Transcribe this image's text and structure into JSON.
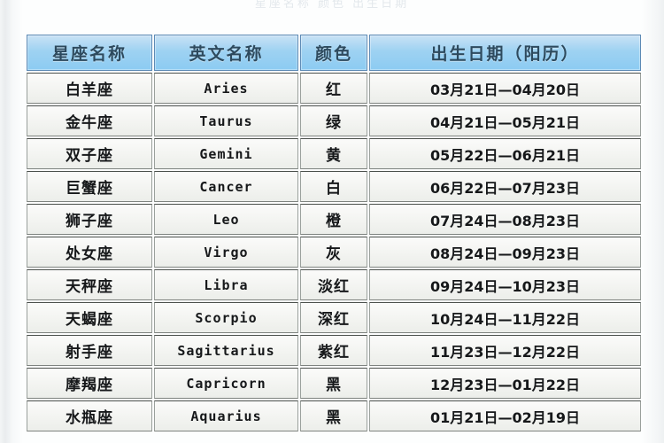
{
  "page": {
    "top_cutoff_text": "星座名称   颜色   出生日期",
    "header_bg": "#8ccbf2",
    "header_text_color": "#2d4a5e",
    "cell_bg": "#f3f4f1",
    "border_color": "#4a4f4b"
  },
  "table": {
    "headers": [
      {
        "label": "星座名称",
        "key": "name"
      },
      {
        "label": "英文名称",
        "key": "english"
      },
      {
        "label": "颜色",
        "key": "color"
      },
      {
        "label": "出生日期（阳历）",
        "key": "birthdate"
      }
    ],
    "rows": [
      {
        "name": "白羊座",
        "english": "Aries",
        "color": "红",
        "birthdate": "03月21日—04月20日"
      },
      {
        "name": "金牛座",
        "english": "Taurus",
        "color": "绿",
        "birthdate": "04月21日—05月21日"
      },
      {
        "name": "双子座",
        "english": "Gemini",
        "color": "黄",
        "birthdate": "05月22日—06月21日"
      },
      {
        "name": "巨蟹座",
        "english": "Cancer",
        "color": "白",
        "birthdate": "06月22日—07月23日"
      },
      {
        "name": "狮子座",
        "english": "Leo",
        "color": "橙",
        "birthdate": "07月24日—08月23日"
      },
      {
        "name": "处女座",
        "english": "Virgo",
        "color": "灰",
        "birthdate": "08月24日—09月23日"
      },
      {
        "name": "天秤座",
        "english": "Libra",
        "color": "淡红",
        "birthdate": "09月24日—10月23日"
      },
      {
        "name": "天蝎座",
        "english": "Scorpio",
        "color": "深红",
        "birthdate": "10月24日—11月22日"
      },
      {
        "name": "射手座",
        "english": "Sagittarius",
        "color": "紫红",
        "birthdate": "11月23日—12月22日"
      },
      {
        "name": "摩羯座",
        "english": "Capricorn",
        "color": "黑",
        "birthdate": "12月23日—01月22日"
      },
      {
        "name": "水瓶座",
        "english": "Aquarius",
        "color": "黑",
        "birthdate": "01月21日—02月19日"
      }
    ]
  }
}
